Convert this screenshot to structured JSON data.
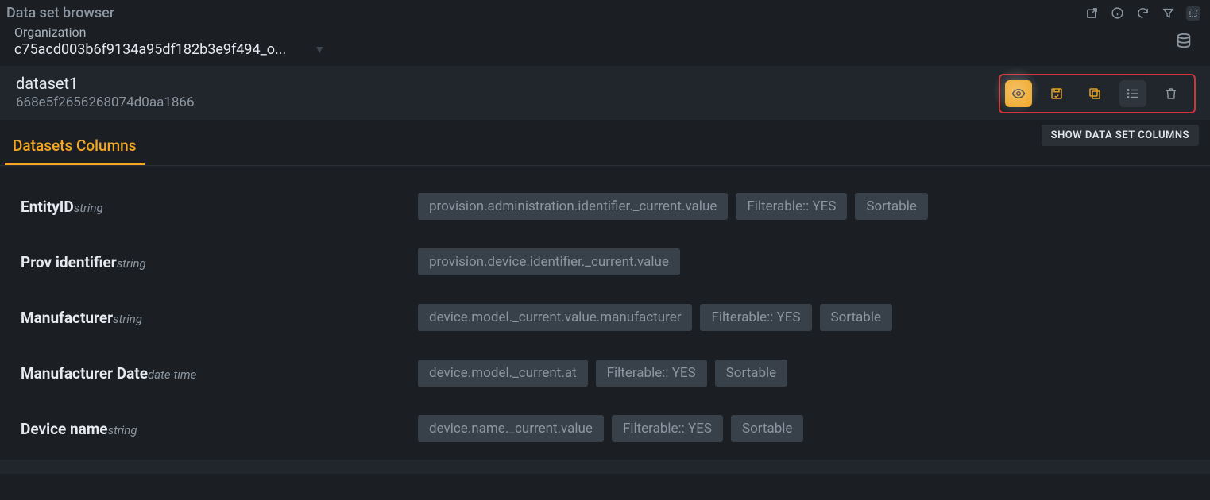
{
  "header": {
    "title": "Data set browser"
  },
  "organization": {
    "label": "Organization",
    "value": "c75acd003b6f9134a95df182b3e9f494_o..."
  },
  "dataset": {
    "name": "dataset1",
    "id": "668e5f2656268074d0aa1866"
  },
  "tooltip": "SHOW DATA SET COLUMNS",
  "tab": {
    "label": "Datasets Columns"
  },
  "columns": [
    {
      "name": "EntityID",
      "type": "string",
      "path": "provision.administration.identifier._current.value",
      "filterable": "Filterable:: YES",
      "sortable": "Sortable"
    },
    {
      "name": "Prov identifier",
      "type": "string",
      "path": "provision.device.identifier._current.value",
      "filterable": null,
      "sortable": null
    },
    {
      "name": "Manufacturer",
      "type": "string",
      "path": "device.model._current.value.manufacturer",
      "filterable": "Filterable:: YES",
      "sortable": "Sortable"
    },
    {
      "name": "Manufacturer Date",
      "type": "date-time",
      "path": "device.model._current.at",
      "filterable": "Filterable:: YES",
      "sortable": "Sortable"
    },
    {
      "name": "Device name",
      "type": "string",
      "path": "device.name._current.value",
      "filterable": "Filterable:: YES",
      "sortable": "Sortable"
    }
  ]
}
